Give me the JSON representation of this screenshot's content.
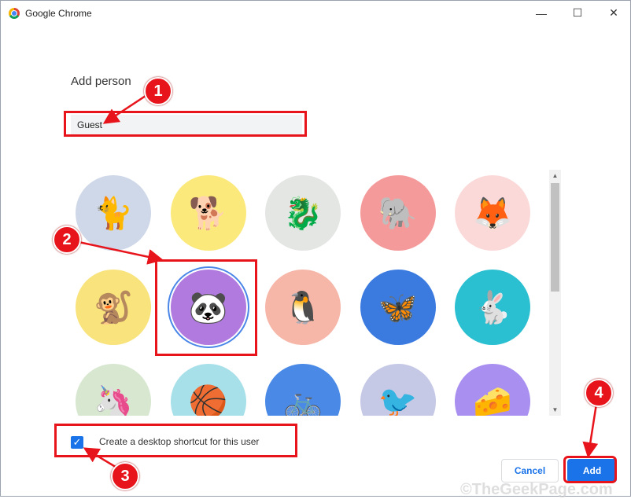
{
  "window": {
    "title": "Google Chrome",
    "minimize": "—",
    "maximize": "☐",
    "close": "✕"
  },
  "dialog": {
    "heading": "Add person",
    "name_input": {
      "value": "Guest"
    },
    "avatars": [
      {
        "name": "cat",
        "color": "#cfd8e8",
        "glyph": "🐈"
      },
      {
        "name": "corgi",
        "color": "#fbe97c",
        "glyph": "🐕"
      },
      {
        "name": "dragon",
        "color": "#e3e6e3",
        "glyph": "🐉"
      },
      {
        "name": "elephant",
        "color": "#f59a9a",
        "glyph": "🐘"
      },
      {
        "name": "fox",
        "color": "#fbd9d9",
        "glyph": "🦊"
      },
      {
        "name": "monkey",
        "color": "#f8e37c",
        "glyph": "🐒"
      },
      {
        "name": "panda",
        "color": "#b07adf",
        "glyph": "🐼",
        "selected": true
      },
      {
        "name": "penguin",
        "color": "#f6b6a8",
        "glyph": "🐧"
      },
      {
        "name": "butterfly",
        "color": "#3b7be0",
        "glyph": "🦋"
      },
      {
        "name": "rabbit",
        "color": "#2bc0d1",
        "glyph": "🐇"
      },
      {
        "name": "unicorn",
        "color": "#d7e7d0",
        "glyph": "🦄"
      },
      {
        "name": "basketball",
        "color": "#a8e0ea",
        "glyph": "🏀"
      },
      {
        "name": "bicycle",
        "color": "#4a8ae6",
        "glyph": "🚲"
      },
      {
        "name": "bird",
        "color": "#c5c9e6",
        "glyph": "🐦"
      },
      {
        "name": "cheese",
        "color": "#a88ff0",
        "glyph": "🧀"
      }
    ],
    "shortcut_checkbox": {
      "checked": true,
      "label": "Create a desktop shortcut for this user"
    },
    "cancel_label": "Cancel",
    "add_label": "Add"
  },
  "annotations": {
    "steps": [
      "1",
      "2",
      "3",
      "4"
    ],
    "color": "#e8141b",
    "watermark": "©TheGeekPage.com"
  }
}
